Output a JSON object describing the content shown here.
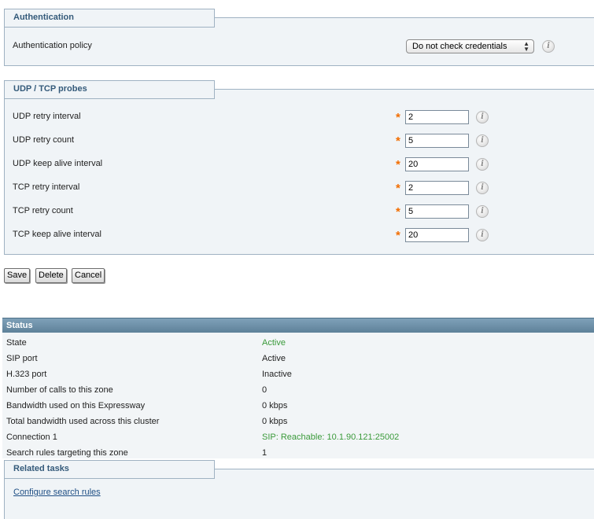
{
  "authentication": {
    "title": "Authentication",
    "policy_label": "Authentication policy",
    "policy_value": "Do not check credentials"
  },
  "probes": {
    "title": "UDP / TCP probes",
    "rows": [
      {
        "label": "UDP retry interval",
        "value": "2"
      },
      {
        "label": "UDP retry count",
        "value": "5"
      },
      {
        "label": "UDP keep alive interval",
        "value": "20"
      },
      {
        "label": "TCP retry interval",
        "value": "2"
      },
      {
        "label": "TCP retry count",
        "value": "5"
      },
      {
        "label": "TCP keep alive interval",
        "value": "20"
      }
    ],
    "required_mark": "*"
  },
  "buttons": {
    "save": "Save",
    "delete": "Delete",
    "cancel": "Cancel"
  },
  "status": {
    "title": "Status",
    "rows": [
      {
        "label": "State",
        "value": "Active"
      },
      {
        "label": "SIP port",
        "value": "Active"
      },
      {
        "label": "H.323 port",
        "value": "Inactive"
      },
      {
        "label": "Number of calls to this zone",
        "value": "0"
      },
      {
        "label": "Bandwidth used on this Expressway",
        "value": "0 kbps"
      },
      {
        "label": "Total bandwidth used across this cluster",
        "value": "0 kbps"
      },
      {
        "label": "Connection 1",
        "value": "SIP: Reachable: 10.1.90.121:25002"
      },
      {
        "label": "Search rules targeting this zone",
        "value": "1"
      }
    ]
  },
  "related_tasks": {
    "title": "Related tasks",
    "link": "Configure search rules"
  },
  "icons": {
    "info": "info-icon",
    "select_arrows": "updown-arrows-icon"
  },
  "colors": {
    "required": "#f26d00",
    "active_status": "#3a9a3a",
    "panel_bg": "#f0f4f7",
    "header_bg": "#6a8da5",
    "link": "#1f4f85"
  }
}
